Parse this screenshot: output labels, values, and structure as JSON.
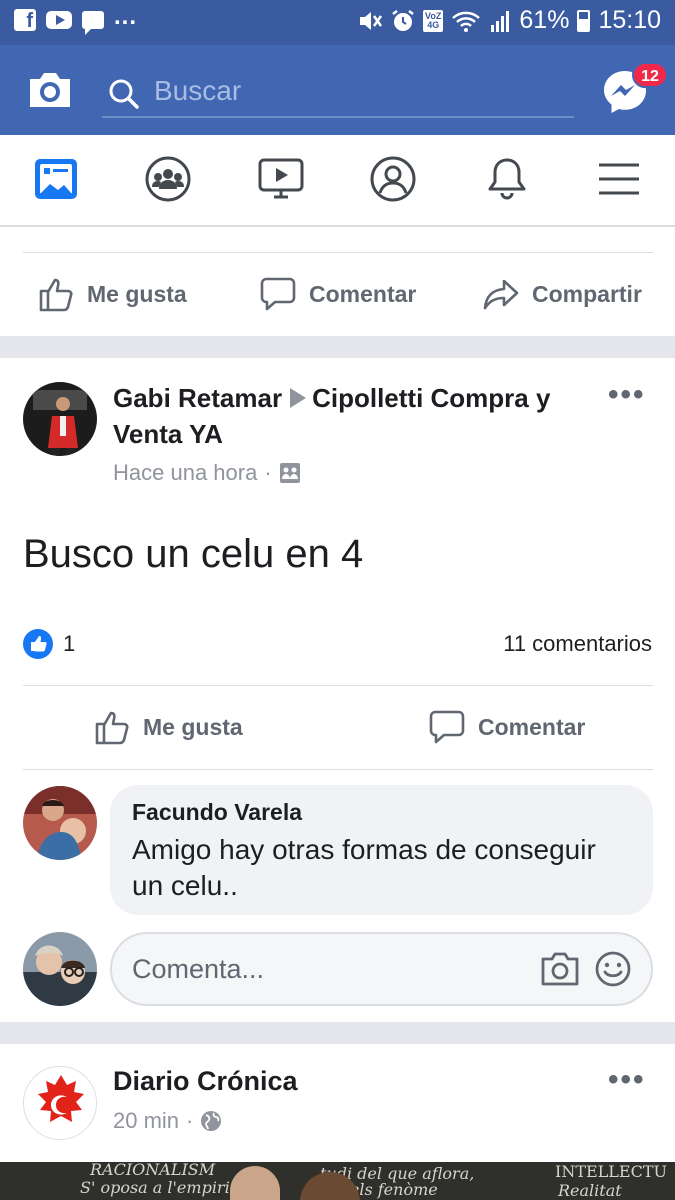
{
  "status_bar": {
    "dots": "...",
    "battery_percent": "61%",
    "time": "15:10",
    "volte_label": "VoZ 4G",
    "icons": [
      "facebook-icon",
      "youtube-icon",
      "message-icon",
      "mute-icon",
      "alarm-icon",
      "volte-icon",
      "wifi-icon",
      "signal-icon",
      "battery-icon"
    ]
  },
  "header": {
    "search_placeholder": "Buscar",
    "messenger_badge": "12",
    "accent": "#4267b2"
  },
  "tabs": [
    "news-feed-icon",
    "groups-icon",
    "watch-icon",
    "profile-icon",
    "notifications-icon",
    "menu-icon"
  ],
  "prev_post_actions": {
    "like": "Me gusta",
    "comment": "Comentar",
    "share": "Compartir"
  },
  "post": {
    "author": "Gabi Retamar",
    "group": "Cipolletti Compra y Venta YA",
    "time": "Hace una hora",
    "text": "Busco un celu en 4",
    "reactions": "1",
    "comments": "11 comentarios",
    "like_label": "Me gusta",
    "comment_label": "Comentar"
  },
  "comment": {
    "author": "Facundo Varela",
    "text": "Amigo hay otras formas de conseguir un celu.."
  },
  "compose": {
    "placeholder": "Comenta..."
  },
  "post2": {
    "author": "Diario Crónica",
    "time": "20 min"
  }
}
